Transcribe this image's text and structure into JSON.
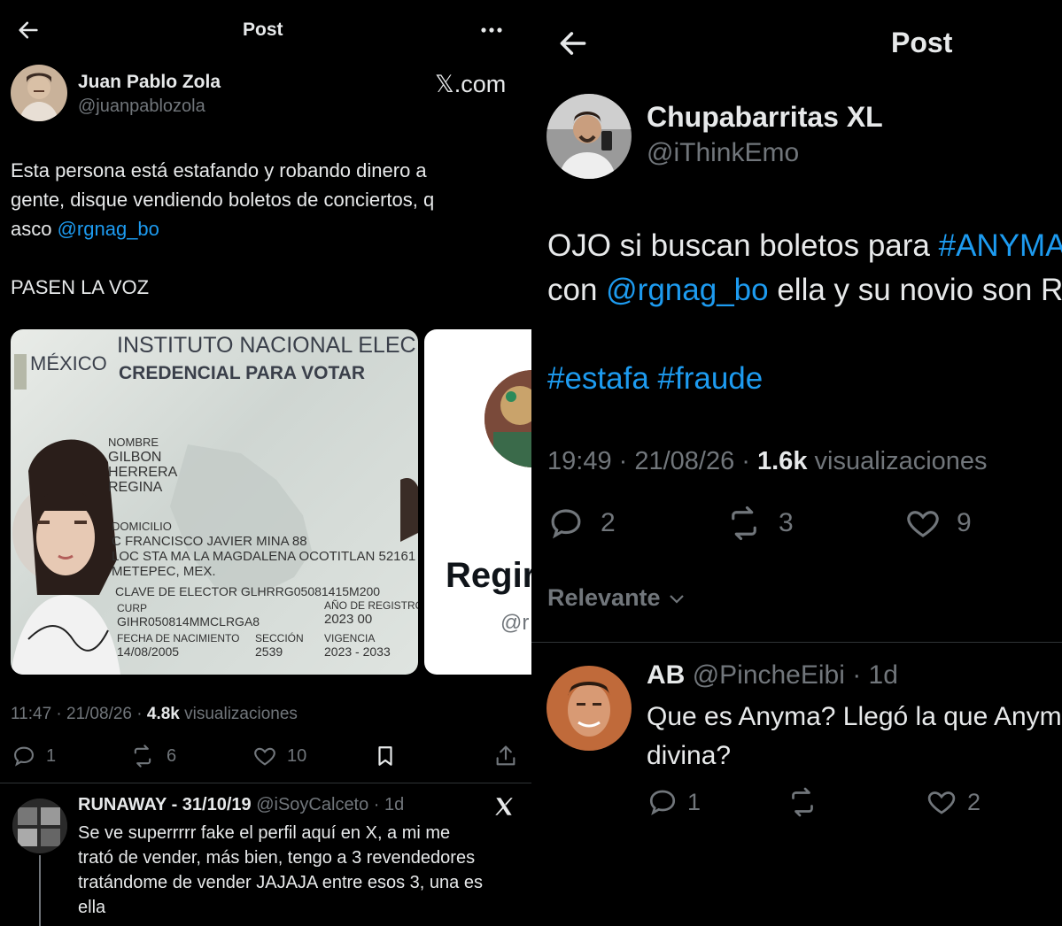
{
  "left": {
    "header": {
      "title": "Post"
    },
    "author": {
      "name": "Juan Pablo Zola",
      "handle": "@juanpablozola"
    },
    "watermark": "𝕏.com",
    "tweet": {
      "line1": "Esta persona está estafando y robando dinero a",
      "line2": "gente, disque vendiendo boletos de conciertos, q",
      "line3_prefix": "asco ",
      "mention": "@rgnag_bo",
      "line4": "PASEN LA VOZ"
    },
    "id_card": {
      "country": "MÉXICO",
      "institute": "INSTITUTO NACIONAL ELEC",
      "credential": "CREDENCIAL PARA VOTAR",
      "name_label": "NOMBRE",
      "name1": "GILBON",
      "name2": "HERRERA",
      "name3": "REGINA",
      "address_label": "DOMICILIO",
      "address1": "C FRANCISCO JAVIER MINA 88",
      "address2": "LOC STA MA LA MAGDALENA OCOTITLAN 52161",
      "address3": "METEPEC, MEX.",
      "clave": "CLAVE DE ELECTOR  GLHRRG05081415M200",
      "curp_label": "CURP",
      "curp": "GIHR050814MMCLRGA8",
      "ano_label": "AÑO DE REGISTRO",
      "ano": "2023 00",
      "fecha_label": "FECHA DE NACIMIENTO",
      "fecha": "14/08/2005",
      "seccion_label": "SECCIÓN",
      "seccion": "2539",
      "vigencia_label": "VIGENCIA",
      "vigencia": "2023 - 2033"
    },
    "profile_card": {
      "name": "Regir",
      "handle": "@r"
    },
    "meta": {
      "time": "11:47 · 21/08/26 · ",
      "views": "4.8k",
      "views_label": " visualizaciones"
    },
    "actions": {
      "replies": "1",
      "retweets": "6",
      "likes": "10"
    },
    "reply": {
      "name": "RUNAWAY - 31/10/19",
      "handle": "@iSoyCalceto · 1d",
      "line1": "Se ve superrrrr fake el perfil aquí en X, a mi me",
      "line2": "trató de vender, más bien, tengo a 3 revendedores",
      "line3": "tratándome de vender JAJAJA entre esos 3, una es",
      "line4": "ella"
    }
  },
  "right": {
    "header": {
      "title": "Post"
    },
    "author": {
      "name": "Chupabarritas XL",
      "handle": "@iThinkEmo"
    },
    "tweet": {
      "line1_prefix": "OJO si buscan boletos para ",
      "hashtag1": "#ANYMA",
      "line2_prefix": "con ",
      "mention": "@rgnag_bo",
      "line2_suffix": " ella y su novio son R",
      "hashtags": "#estafa #fraude"
    },
    "meta": {
      "time": "19:49 · 21/08/26 · ",
      "views": "1.6k",
      "views_label": " visualizaciones"
    },
    "actions": {
      "replies": "2",
      "retweets": "3",
      "likes": "9"
    },
    "sort": {
      "label": "Relevante"
    },
    "reply": {
      "name": "AB",
      "handle": "@PincheEibi · 1d",
      "line1": "Que es Anyma? Llegó la que Anyma",
      "line2": "divina?",
      "replies": "1",
      "likes": "2"
    }
  },
  "colors": {
    "link": "#1d9bf0",
    "muted": "#71767b",
    "text": "#e7e9ea",
    "background": "#000000"
  }
}
